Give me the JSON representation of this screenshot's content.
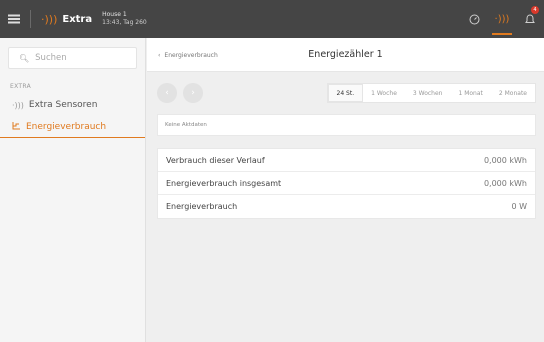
{
  "topbar": {
    "app_name": "Extra",
    "house_name": "House 1",
    "house_time": "13:43, Tag 260",
    "notification_count": "4"
  },
  "sidebar": {
    "search_placeholder": "Suchen",
    "section": "EXTRA",
    "items": [
      {
        "label": "Extra Sensoren",
        "icon": "signal-icon"
      },
      {
        "label": "Energieverbrauch",
        "icon": "energy-icon",
        "active": true
      }
    ]
  },
  "main": {
    "back_label": "Energieverbrauch",
    "title": "Energiezähler 1",
    "ranges": [
      "24 St.",
      "1 Woche",
      "3 Wochen",
      "1 Monat",
      "2 Monate"
    ],
    "active_range": "24 St.",
    "message": "Keine Aktdaten",
    "rows": [
      {
        "label": "Verbrauch dieser Verlauf",
        "value": "0,000 kWh"
      },
      {
        "label": "Energieverbrauch insgesamt",
        "value": "0,000 kWh"
      },
      {
        "label": "Energieverbrauch",
        "value": "0 W"
      }
    ]
  },
  "colors": {
    "accent": "#e07a1f",
    "topbar": "#454545",
    "badge": "#d9392b"
  }
}
